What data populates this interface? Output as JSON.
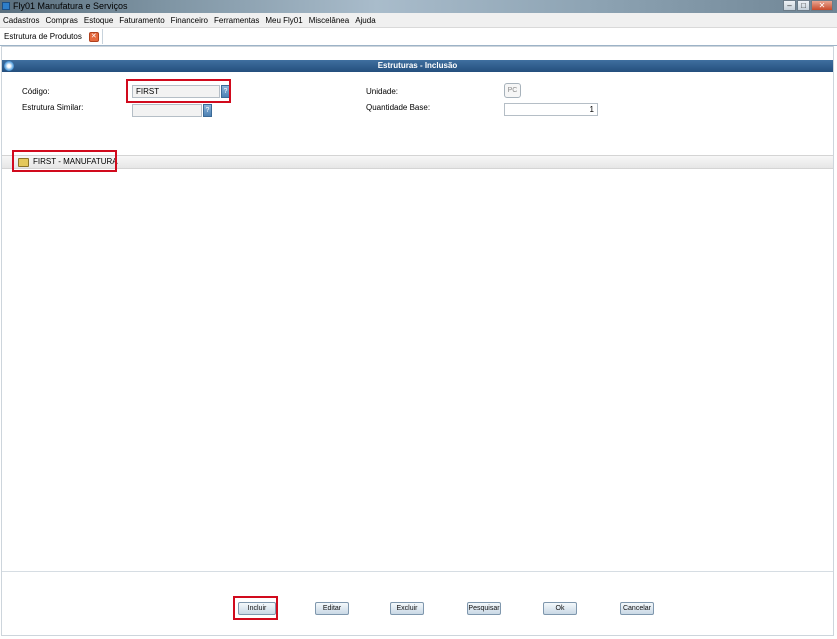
{
  "window": {
    "title": "Fly01 Manufatura e Serviços",
    "controls": [
      "–",
      "□",
      "✕"
    ]
  },
  "menu": [
    "Cadastros",
    "Compras",
    "Estoque",
    "Faturamento",
    "Financeiro",
    "Ferramentas",
    "Meu Fly01",
    "Miscelânea",
    "Ajuda"
  ],
  "tab": {
    "label": "Estrutura de Produtos",
    "close_glyph": "✕"
  },
  "form": {
    "header": "Estruturas - Inclusão",
    "codigo_label": "Código:",
    "codigo_value": "FIRST",
    "lookup_glyph": "?",
    "similar_label": "Estrutura Similar:",
    "similar_value": "",
    "unidade_label": "Unidade:",
    "unidade_value": "PC",
    "qtd_label": "Quantidade Base:",
    "qtd_value": "1"
  },
  "tree": {
    "root_label": "FIRST - MANUFATURA",
    "icon": "folder-icon"
  },
  "buttons": {
    "incluir": "Incluir",
    "editar": "Editar",
    "excluir": "Excluir",
    "pesquisar": "Pesquisar",
    "ok": "Ok",
    "cancelar": "Cancelar"
  },
  "colors": {
    "header": "#2f5d8c",
    "highlight": "#d10a1d"
  }
}
